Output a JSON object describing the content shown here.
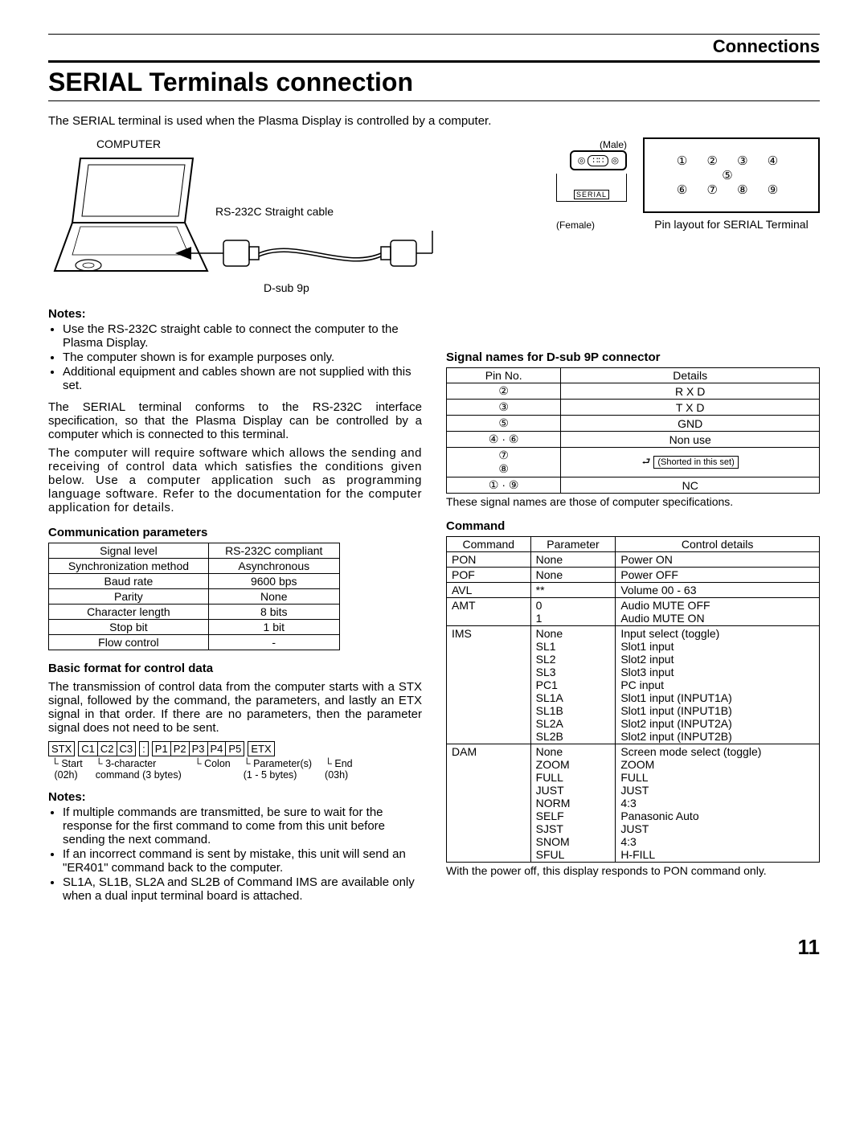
{
  "header_section": "Connections",
  "title": "SERIAL Terminals connection",
  "intro": "The SERIAL terminal is used when the Plasma Display is controlled by a computer.",
  "diagram": {
    "computer_label": "COMPUTER",
    "male_label": "(Male)",
    "female_label": "(Female)",
    "cable_label": "RS-232C Straight cable",
    "serial_tag": "SERIAL",
    "dsub_label": "D-sub 9p",
    "pin_layout_label": "Pin layout for SERIAL Terminal",
    "pins_row1": "① ② ③ ④ ⑤",
    "pins_row2": "⑥ ⑦ ⑧ ⑨"
  },
  "notes_h": "Notes:",
  "notes_top": [
    "Use the RS-232C straight cable to connect the computer to the Plasma Display.",
    "The computer shown is for example purposes only.",
    "Additional equipment and cables shown are not supplied with this set."
  ],
  "para1": "The SERIAL terminal conforms to the RS-232C interface specification, so that the Plasma Display can be controlled by a computer which is connected to this terminal.",
  "para2": "The computer will require software which allows the sending and receiving of control data which satisfies the conditions given below. Use a computer application such as programming language software. Refer to the documentation for the computer application for details.",
  "comm_h": "Communication parameters",
  "comm_params": [
    [
      "Signal level",
      "RS-232C compliant"
    ],
    [
      "Synchronization method",
      "Asynchronous"
    ],
    [
      "Baud rate",
      "9600 bps"
    ],
    [
      "Parity",
      "None"
    ],
    [
      "Character length",
      "8 bits"
    ],
    [
      "Stop bit",
      "1 bit"
    ],
    [
      "Flow control",
      "-"
    ]
  ],
  "format_h": "Basic format for control data",
  "format_p": "The transmission of control data from the computer starts with a STX signal, followed by the command, the parameters, and lastly an ETX signal in that order. If there are no parameters, then the parameter signal does not need to be sent.",
  "format_boxes": {
    "stx": "STX",
    "c": [
      "C1",
      "C2",
      "C3"
    ],
    "colon": ":",
    "p": [
      "P1",
      "P2",
      "P3",
      "P4",
      "P5"
    ],
    "etx": "ETX"
  },
  "format_legend": {
    "start": "Start\n (02h)",
    "cmd": "3-character\ncommand (3 bytes)",
    "colon": "Colon",
    "param": "Parameter(s)\n(1 - 5 bytes)",
    "end": "End\n(03h)"
  },
  "notes_bottom": [
    "If multiple commands are transmitted, be sure to wait for the response for the first command to come from this unit before sending the next command.",
    "If an incorrect command is sent by mistake, this unit will send an \"ER401\" command back to the computer.",
    "SL1A, SL1B, SL2A and SL2B of Command IMS are available only when a dual input terminal board is attached."
  ],
  "signal_h": "Signal names for D-sub 9P connector",
  "signal_header": [
    "Pin No.",
    "Details"
  ],
  "signal_rows": [
    {
      "pin": "②",
      "detail": "R X D"
    },
    {
      "pin": "③",
      "detail": "T X D"
    },
    {
      "pin": "⑤",
      "detail": "GND"
    },
    {
      "pin": "④ · ⑥",
      "detail": "Non use"
    },
    {
      "pin": "⑦⑧",
      "detail": "(Shorted in this set)",
      "shorted": true
    },
    {
      "pin": "① · ⑨",
      "detail": "NC"
    }
  ],
  "signal_note": "These signal names are those of computer specifications.",
  "cmd_h": "Command",
  "cmd_header": [
    "Command",
    "Parameter",
    "Control details"
  ],
  "cmd_rows": [
    {
      "c": "PON",
      "p": [
        "None"
      ],
      "d": [
        "Power ON"
      ]
    },
    {
      "c": "POF",
      "p": [
        "None"
      ],
      "d": [
        "Power OFF"
      ]
    },
    {
      "c": "AVL",
      "p": [
        "**"
      ],
      "d": [
        "Volume 00 - 63"
      ]
    },
    {
      "c": "AMT",
      "p": [
        "0",
        "1"
      ],
      "d": [
        "Audio MUTE OFF",
        "Audio MUTE ON"
      ]
    },
    {
      "c": "IMS",
      "p": [
        "None",
        "SL1",
        "SL2",
        "SL3",
        "PC1",
        "SL1A",
        "SL1B",
        "SL2A",
        "SL2B"
      ],
      "d": [
        "Input select (toggle)",
        "Slot1 input",
        "Slot2 input",
        "Slot3 input",
        "PC input",
        "Slot1 input (INPUT1A)",
        "Slot1 input (INPUT1B)",
        "Slot2 input (INPUT2A)",
        "Slot2 input (INPUT2B)"
      ]
    },
    {
      "c": "DAM",
      "p": [
        "None",
        "ZOOM",
        "FULL",
        "JUST",
        "NORM",
        "SELF",
        "SJST",
        "SNOM",
        "SFUL"
      ],
      "d": [
        "Screen mode select (toggle)",
        "ZOOM",
        "FULL",
        "JUST",
        "4:3",
        "Panasonic Auto",
        "JUST",
        "4:3",
        "H-FILL"
      ]
    }
  ],
  "cmd_note": "With the power off, this display responds to PON command only.",
  "page_num": "11"
}
